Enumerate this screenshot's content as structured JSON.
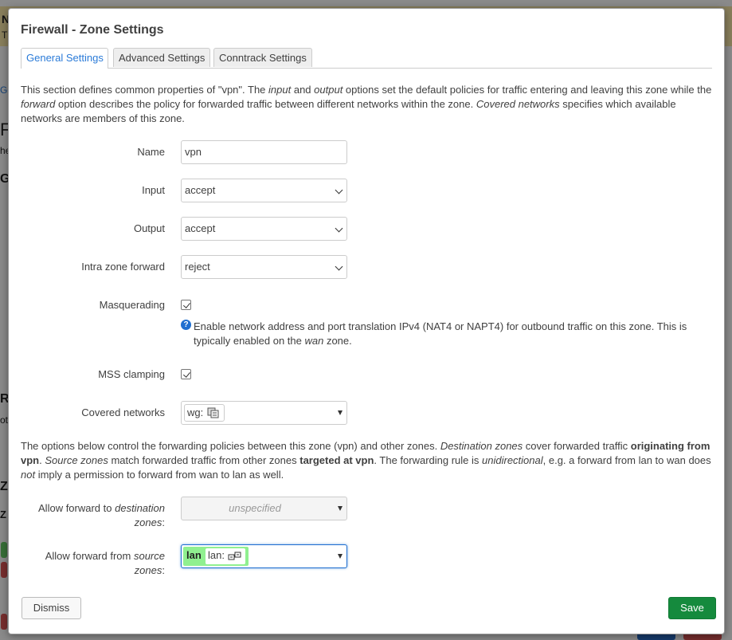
{
  "modal": {
    "title": "Firewall - Zone Settings",
    "tabs": [
      {
        "label": "General Settings",
        "active": true
      },
      {
        "label": "Advanced Settings",
        "active": false
      },
      {
        "label": "Conntrack Settings",
        "active": false
      }
    ],
    "intro": {
      "t1": "This section defines common properties of \"vpn\". The ",
      "em1": "input",
      "t2": " and ",
      "em2": "output",
      "t3": " options set the default policies for traffic entering and leaving this zone while the ",
      "em3": "forward",
      "t4": " option describes the policy for forwarded traffic between different networks within the zone. ",
      "em4": "Covered networks",
      "t5": " specifies which available networks are members of this zone."
    },
    "fields": {
      "name": {
        "label": "Name",
        "value": "vpn"
      },
      "input": {
        "label": "Input",
        "value": "accept"
      },
      "output": {
        "label": "Output",
        "value": "accept"
      },
      "intra_forward": {
        "label": "Intra zone forward",
        "value": "reject"
      },
      "masquerading": {
        "label": "Masquerading",
        "checked": true,
        "help": {
          "t1": "Enable network address and port translation IPv4 (NAT4 or NAPT4) for outbound traffic on this zone. This is typically enabled on the ",
          "em": "wan",
          "t2": " zone."
        }
      },
      "mss_clamping": {
        "label": "MSS clamping",
        "checked": true
      },
      "covered_networks": {
        "label": "Covered networks",
        "chip_label": "wg:",
        "chip_icon": "network-interface-icon"
      }
    },
    "forwarding_desc": {
      "t1": "The options below control the forwarding policies between this zone (vpn) and other zones. ",
      "em1": "Destination zones",
      "t2": " cover forwarded traffic ",
      "b1": "originating from vpn",
      "t3": ". ",
      "em2": "Source zones",
      "t4": " match forwarded traffic from other zones ",
      "b2": "targeted at vpn",
      "t5": ". The forwarding rule is ",
      "em3": "unidirectional",
      "t6": ", e.g. a forward from lan to wan does ",
      "em4": "not",
      "t7": " imply a permission to forward from wan to lan as well."
    },
    "forward_to": {
      "label_pre": "Allow forward to ",
      "label_em": "destination",
      "label_post": " zones",
      "colon": ":",
      "placeholder": "unspecified"
    },
    "forward_from": {
      "label_pre": "Allow forward from ",
      "label_em": "source",
      "label_post": " zones",
      "colon": ":",
      "zone_name": "lan",
      "zone_network": "lan:",
      "zone_color": "#90f090",
      "network_icon": "ethernet-ports-icon"
    },
    "buttons": {
      "dismiss": "Dismiss",
      "save": "Save"
    }
  },
  "background": {
    "frag_n": "N",
    "frag_th": "Th",
    "frag_ge": "Ge",
    "frag_fi": "Fi",
    "frag_the": "he",
    "frag_ge2": "Ge",
    "frag_ro": "Ro",
    "frag_not": "ot",
    "frag_zo": "Zo",
    "frag_z": "Z"
  },
  "colors": {
    "accent": "#2b7bd8",
    "save": "#158a3d",
    "highlight_border": "#1f6fd0"
  }
}
